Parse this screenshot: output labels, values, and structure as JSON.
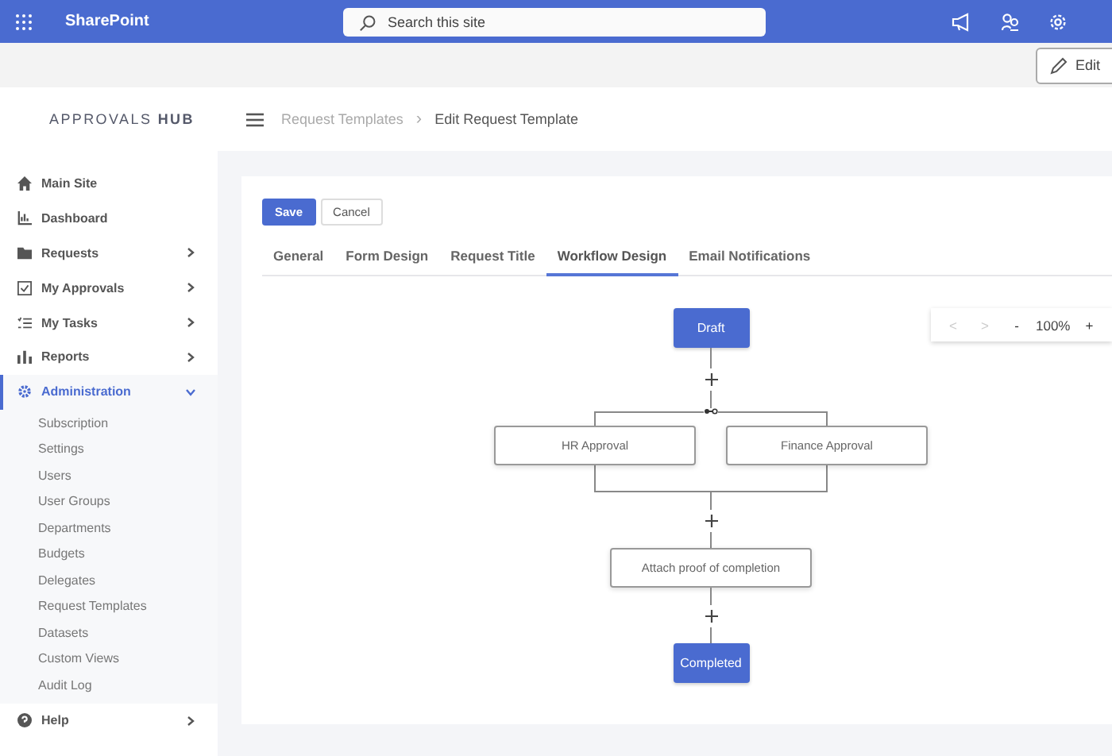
{
  "topbar": {
    "brand": "SharePoint",
    "search": {
      "placeholder": "Search this site"
    }
  },
  "command_bar": {
    "edit_button": "Edit"
  },
  "header": {
    "app_title": "APPROVALS **HUB**",
    "breadcrumb_separator": "›",
    "breadcrumb": [
      {
        "label": "Request Templates",
        "current": false
      },
      {
        "label": "Edit Request Template",
        "current": true
      }
    ]
  },
  "sidebar": {
    "items": [
      {
        "label": "Main Site",
        "has_arrow": false,
        "selected": false
      },
      {
        "label": "Dashboard",
        "has_arrow": false,
        "selected": false
      },
      {
        "label": "Requests",
        "has_arrow": true,
        "selected": false
      },
      {
        "label": "My Approvals",
        "has_arrow": true,
        "selected": false
      },
      {
        "label": "My Tasks",
        "has_arrow": true,
        "selected": false
      },
      {
        "label": "Reports",
        "has_arrow": true,
        "selected": false
      },
      {
        "label": "Administration",
        "has_arrow": true,
        "selected": true,
        "expanded": true,
        "children": [
          {
            "label": "Subscription"
          },
          {
            "label": "Settings"
          },
          {
            "label": "Users"
          },
          {
            "label": "User Groups"
          },
          {
            "label": "Departments"
          },
          {
            "label": "Budgets"
          },
          {
            "label": "Delegates"
          },
          {
            "label": "Request Templates"
          },
          {
            "label": "Datasets"
          },
          {
            "label": "Custom Views"
          },
          {
            "label": "Audit Log"
          }
        ]
      },
      {
        "label": "Help",
        "has_arrow": true,
        "selected": false
      }
    ]
  },
  "actions": {
    "save": "Save",
    "cancel": "Cancel"
  },
  "tabs": [
    {
      "label": "General",
      "selected": false
    },
    {
      "label": "Form Design",
      "selected": false
    },
    {
      "label": "Request Title",
      "selected": false
    },
    {
      "label": "Workflow Design",
      "selected": true
    },
    {
      "label": "Email Notifications",
      "selected": false
    }
  ],
  "zoom_control": {
    "previous": {
      "label": "<",
      "disabled": true
    },
    "next": {
      "label": ">",
      "disabled": true
    },
    "zoom_out": "-",
    "zoom_level": "100%",
    "zoom_in": "+"
  },
  "flow": [
    {
      "kind": "status",
      "label": "Draft"
    },
    {
      "kind": "parallel",
      "branches": [
        {
          "label": "HR Approval"
        },
        {
          "label": "Finance Approval"
        }
      ]
    },
    {
      "kind": "step",
      "label": "Attach proof of completion"
    },
    {
      "kind": "status",
      "label": "Completed"
    }
  ]
}
